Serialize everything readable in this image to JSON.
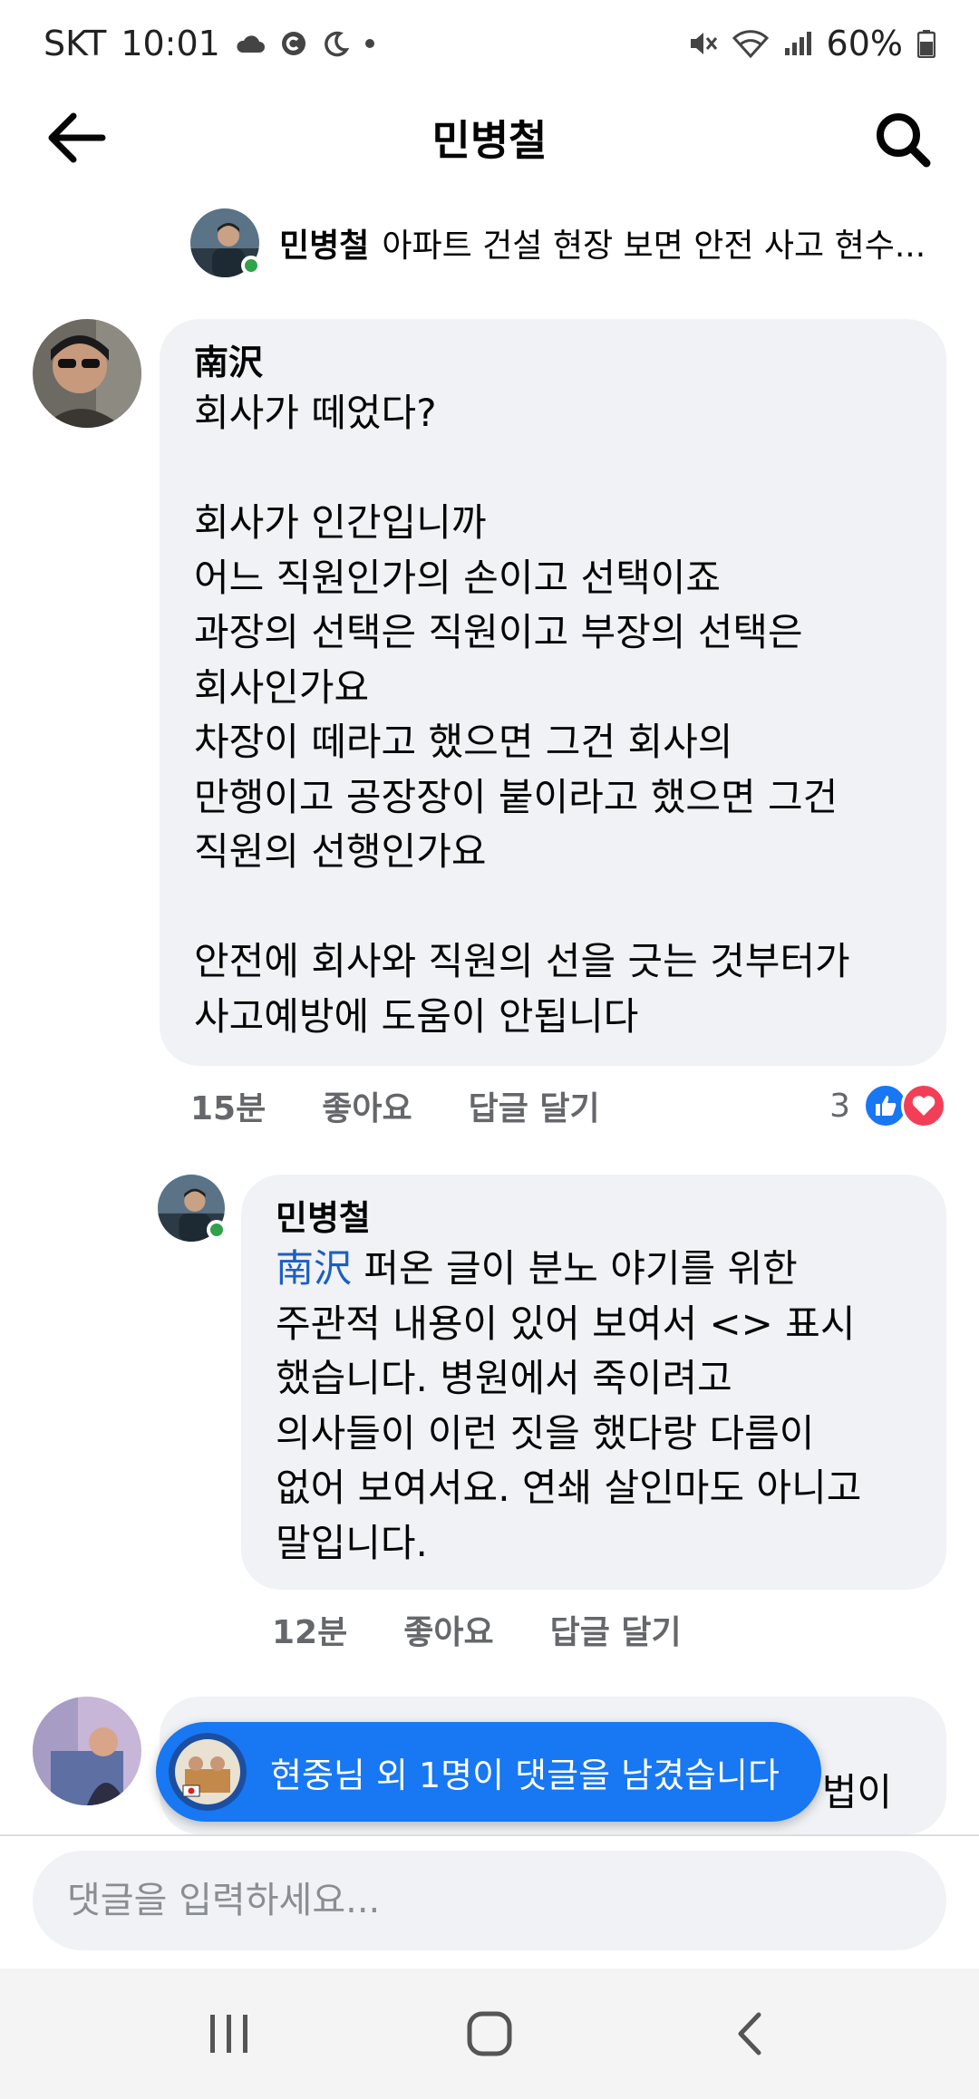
{
  "status_bar": {
    "carrier": "SKT",
    "time": "10:01",
    "battery": "60%"
  },
  "header": {
    "title": "민병철",
    "back_icon": "arrow-left-icon",
    "search_icon": "search-icon"
  },
  "post_preview": {
    "author": "민병철",
    "text": "아파트 건설 현장 보면 안전 사고 현수..."
  },
  "comments": [
    {
      "author": "南沢",
      "text": "회사가 떼었다?\n\n회사가 인간입니까\n어느 직원인가의 손이고 선택이죠\n과장의 선택은 직원이고 부장의 선택은\n회사인가요\n차장이 떼라고 했으면 그건 회사의\n만행이고 공장장이 붙이라고 했으면 그건\n직원의 선행인가요\n\n안전에 회사와 직원의 선을 긋는 것부터가\n사고예방에 도움이 안됩니다",
      "time": "15분",
      "like_label": "좋아요",
      "reply_label": "답글 달기",
      "reaction_count": "3"
    },
    {
      "author": "민병철",
      "mention": "南沢",
      "text": " 퍼온 글이 분노 야기를 위한\n주관적 내용이 있어 보여서 <> 표시\n했습니다. 병원에서 죽이려고\n의사들이 이런 짓을 했다랑 다름이\n없어 보여서요. 연쇄 살인마도 아니고\n말입니다.",
      "time": "12분",
      "like_label": "좋아요",
      "reply_label": "답글 달기"
    }
  ],
  "partial_comment": {
    "text_fragment": "법이"
  },
  "toast": {
    "text": "현중님 외 1명이 댓글을 남겼습니다"
  },
  "input": {
    "placeholder": "댓글을 입력하세요..."
  },
  "nav": {
    "recents_icon": "recent-apps-icon",
    "home_icon": "home-icon",
    "back_icon": "back-chevron-icon"
  },
  "colors": {
    "accent": "#1877f2",
    "bubble": "#f0f2f5",
    "mention": "#1b5fc1",
    "online": "#31a24c",
    "love": "#f33e58"
  }
}
